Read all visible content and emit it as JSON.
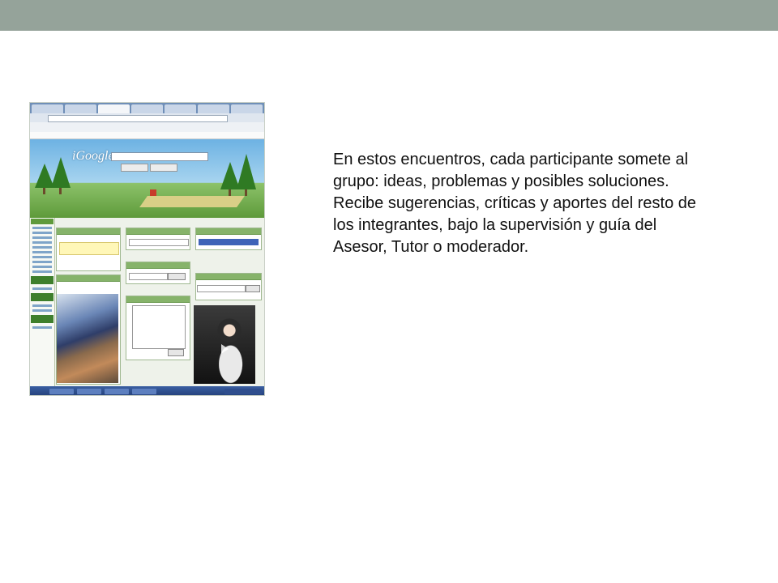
{
  "slide": {
    "paragraphs": [
      "En estos encuentros, cada participante somete al  grupo: ideas, problemas y posibles soluciones.",
      "Recibe sugerencias, críticas y aportes del resto de  los integrantes, bajo la supervisión y guía del  Asesor, Tutor o moderador."
    ]
  },
  "screenshot": {
    "logo_text": "iGoogle",
    "colors": {
      "top_band": "#95a39a",
      "gadget_header": "#86b36a",
      "sky": "#6db2e3",
      "grass": "#5e9a3a"
    },
    "icons": [
      "play-icon"
    ]
  }
}
